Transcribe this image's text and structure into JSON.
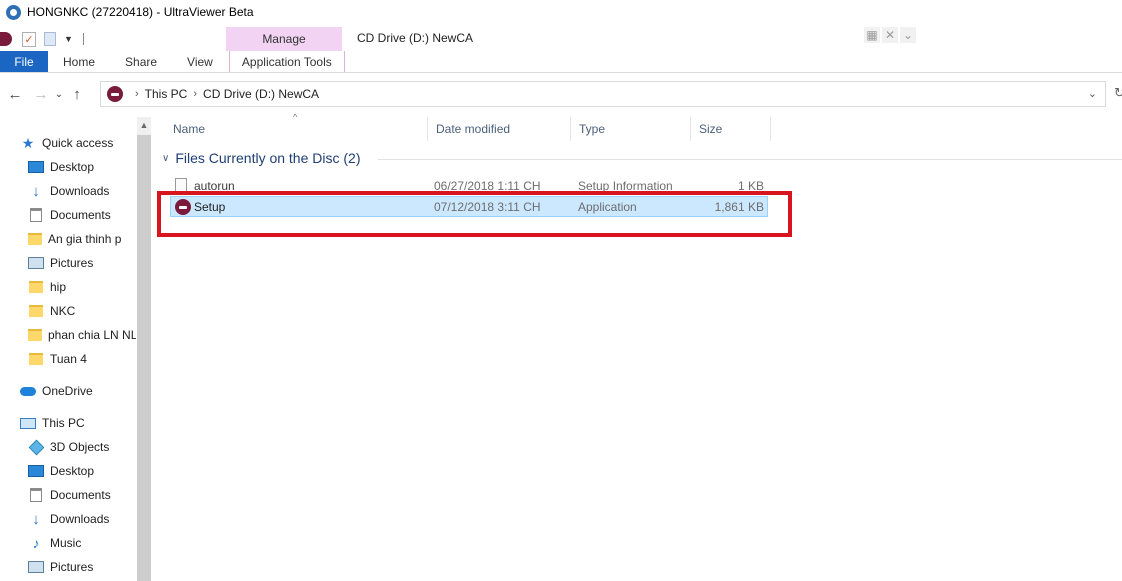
{
  "window": {
    "title": "HONGNKC (27220418) - UltraViewer Beta"
  },
  "ribbon": {
    "context_group": "Manage",
    "context_title": "CD Drive (D:) NewCA",
    "tabs": [
      {
        "label": "File"
      },
      {
        "label": "Home"
      },
      {
        "label": "Share"
      },
      {
        "label": "View"
      },
      {
        "label": "Application Tools"
      }
    ]
  },
  "address": {
    "back_icon": "back-arrow-icon",
    "forward_icon": "forward-arrow-icon",
    "recent_icon": "chevron-down-icon",
    "up_icon": "up-arrow-icon",
    "breadcrumbs": [
      "This PC",
      "CD Drive (D:) NewCA"
    ]
  },
  "sidebar": {
    "quick_access": {
      "label": "Quick access",
      "items": [
        {
          "label": "Desktop",
          "icon": "desktop-icon",
          "pinned": true
        },
        {
          "label": "Downloads",
          "icon": "downloads-icon",
          "pinned": true
        },
        {
          "label": "Documents",
          "icon": "documents-icon",
          "pinned": true
        },
        {
          "label": "An gia thinh p",
          "icon": "folder-icon",
          "pinned": true
        },
        {
          "label": "Pictures",
          "icon": "pictures-icon",
          "pinned": true
        },
        {
          "label": "hip",
          "icon": "folder-icon",
          "pinned": false
        },
        {
          "label": "NKC",
          "icon": "folder-icon",
          "pinned": false
        },
        {
          "label": "phan chia LN NL",
          "icon": "folder-icon",
          "pinned": false
        },
        {
          "label": "Tuan 4",
          "icon": "folder-icon",
          "pinned": false
        }
      ]
    },
    "onedrive": {
      "label": "OneDrive"
    },
    "this_pc": {
      "label": "This PC",
      "items": [
        {
          "label": "3D Objects",
          "icon": "3d-objects-icon"
        },
        {
          "label": "Desktop",
          "icon": "desktop-icon"
        },
        {
          "label": "Documents",
          "icon": "documents-icon"
        },
        {
          "label": "Downloads",
          "icon": "downloads-icon"
        },
        {
          "label": "Music",
          "icon": "music-icon"
        },
        {
          "label": "Pictures",
          "icon": "pictures-icon"
        }
      ]
    }
  },
  "file_list": {
    "columns": [
      "Name",
      "Date modified",
      "Type",
      "Size"
    ],
    "group_title": "Files Currently on the Disc (2)",
    "rows": [
      {
        "name": "autorun",
        "date": "06/27/2018 1:11 CH",
        "type": "Setup Information",
        "size": "1 KB",
        "icon": "setup-info-file-icon",
        "selected": false
      },
      {
        "name": "Setup",
        "date": "07/12/2018 3:11 CH",
        "type": "Application",
        "size": "1,861 KB",
        "icon": "ultraviewer-app-icon",
        "selected": true
      }
    ]
  },
  "colors": {
    "file_tab": "#1a66c2",
    "context_tab": "#f2d3f3",
    "selection": "#cce8ff",
    "highlight_border": "#d8141e"
  }
}
